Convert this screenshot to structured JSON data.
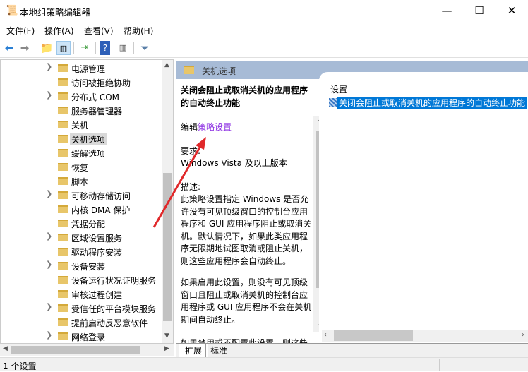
{
  "window": {
    "title": "本地组策略编辑器",
    "minimize": "—",
    "maximize": "☐",
    "close": "✕"
  },
  "menu": [
    "文件(F)",
    "操作(A)",
    "查看(V)",
    "帮助(H)"
  ],
  "tree": [
    {
      "label": "电源管理",
      "expandable": true
    },
    {
      "label": "访问被拒绝协助",
      "expandable": false
    },
    {
      "label": "分布式 COM",
      "expandable": true
    },
    {
      "label": "服务器管理器",
      "expandable": false
    },
    {
      "label": "关机",
      "expandable": false
    },
    {
      "label": "关机选项",
      "expandable": false,
      "selected": true
    },
    {
      "label": "缓解选项",
      "expandable": false
    },
    {
      "label": "恢复",
      "expandable": false
    },
    {
      "label": "脚本",
      "expandable": false
    },
    {
      "label": "可移动存储访问",
      "expandable": true
    },
    {
      "label": "内核 DMA 保护",
      "expandable": false
    },
    {
      "label": "凭据分配",
      "expandable": false
    },
    {
      "label": "区域设置服务",
      "expandable": true
    },
    {
      "label": "驱动程序安装",
      "expandable": false
    },
    {
      "label": "设备安装",
      "expandable": true
    },
    {
      "label": "设备运行状况证明服务",
      "expandable": false
    },
    {
      "label": "审核过程创建",
      "expandable": false
    },
    {
      "label": "受信任的平台模块服务",
      "expandable": true
    },
    {
      "label": "提前启动反恶意软件",
      "expandable": false
    },
    {
      "label": "网络登录",
      "expandable": true
    }
  ],
  "right": {
    "header": "关机选项",
    "desc_title": "关闭会阻止或取消关机的应用程序的自动终止功能",
    "edit_prefix": "编辑",
    "edit_link": "策略设置",
    "req_label": "要求:",
    "req_value": "Windows Vista 及以上版本",
    "desc_label": "描述:",
    "desc_p1": "此策略设置指定 Windows 是否允许没有可见顶级窗口的控制台应用程序和 GUI 应用程序阻止或取消关机。默认情况下，如果此类应用程序无限期地试图取消或阻止关机，则这些应用程序会自动终止。",
    "desc_p2": "如果启用此设置，则没有可见顶级窗口且阻止或取消关机的控制台应用程序或 GUI 应用程序不会在关机期间自动终止。",
    "desc_p3": "如果禁用或不配置此设置，则这些",
    "settings_header": "设置",
    "settings_item": "关闭会阻止或取消关机的应用程序的自动终止功能"
  },
  "tabs": [
    "扩展",
    "标准"
  ],
  "status": "1 个设置"
}
